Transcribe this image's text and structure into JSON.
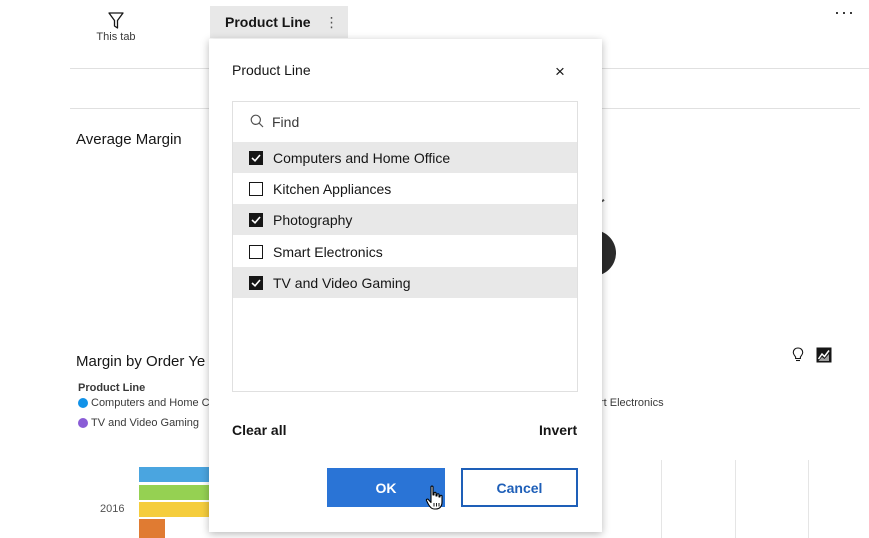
{
  "toolbar": {
    "filter_label": "This tab",
    "tab_label": "Product Line",
    "tab_menu_glyph": "⋮",
    "more_glyph": "···"
  },
  "dashboard": {
    "average_margin_title": "Average Margin",
    "margin_by_year_title": "Margin by Order Ye",
    "legend_title": "Product Line",
    "legend": [
      {
        "label": "Computers and Home C",
        "color": "#1192e8"
      },
      {
        "label": "rt Electronics",
        "color": ""
      },
      {
        "label": "TV and Video Gaming",
        "color": "#8a5cd6"
      }
    ],
    "year_label": "2016",
    "bar_colors": [
      "#4aa5e0",
      "#95d152",
      "#f5cd3d",
      "#e07b32"
    ]
  },
  "modal": {
    "title": "Product Line",
    "close_glyph": "×",
    "search_placeholder": "Find",
    "options": [
      {
        "label": "Computers and Home Office",
        "checked": true
      },
      {
        "label": "Kitchen Appliances",
        "checked": false
      },
      {
        "label": "Photography",
        "checked": true
      },
      {
        "label": "Smart Electronics",
        "checked": false
      },
      {
        "label": "TV and Video Gaming",
        "checked": true
      }
    ],
    "clear_all": "Clear all",
    "invert": "Invert",
    "ok": "OK",
    "cancel": "Cancel"
  },
  "colors": {
    "primary": "#2a74d6",
    "selected_row": "#e8e8e8"
  }
}
